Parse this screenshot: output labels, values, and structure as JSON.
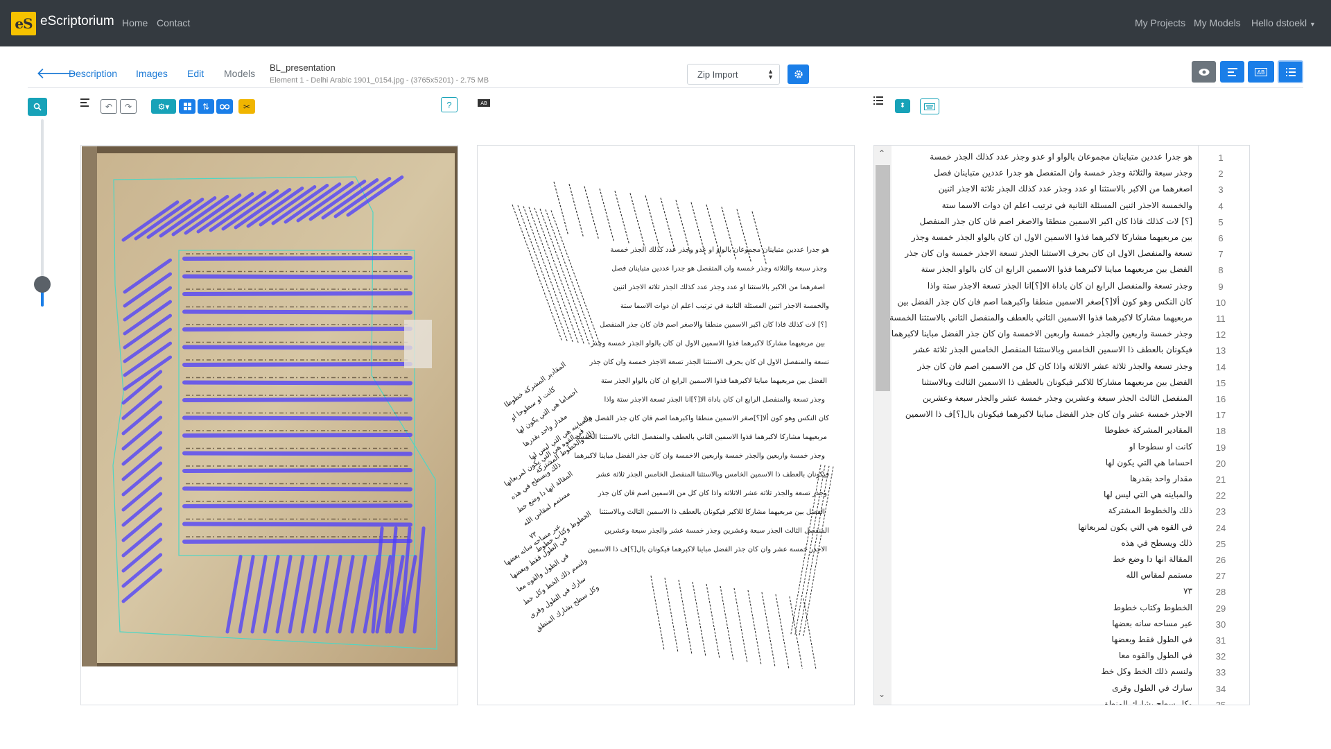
{
  "navbar": {
    "logo_text": "eS",
    "brand": "eScriptorium",
    "home": "Home",
    "contact": "Contact",
    "my_projects": "My Projects",
    "my_models": "My Models",
    "user": "Hello dstoekl"
  },
  "tabs": {
    "description": "Description",
    "images": "Images",
    "edit": "Edit",
    "models": "Models"
  },
  "document": {
    "title": "BL_presentation",
    "subtitle": "Element 1 - Delhi Arabic 1901_0154.jpg - (3765x5201) - 2.75 MB"
  },
  "import_select": {
    "selected": "Zip Import"
  },
  "colors": {
    "accent": "#1a7ee8",
    "navbar": "#343a40",
    "baseline": "#4b3cff",
    "region": "#4fd6c4"
  },
  "icons": {
    "back": "arrow-left-icon",
    "settings": "gear-icon",
    "view": "eye-icon",
    "zoom": "magnifier-icon",
    "help": "question-icon"
  },
  "zoom_level": 0.12,
  "transcription_lines": [
    {
      "n": "1",
      "text": "هو جدرا عددين متباينان مجموعان بالواو او عدو وجذر عدد كذلك الجذر خمسة"
    },
    {
      "n": "2",
      "text": "وجذر سبعة والثلاثة وجذر خمسة وان المتفصل هو جدرا عددين متباينان فصل"
    },
    {
      "n": "3",
      "text": "اصغرهما من الاكبر بالاستثنا او عدد وجذر عدد كذلك الجذر ثلاثة الاجذر اثنين"
    },
    {
      "n": "4",
      "text": "والخمسة الاجذر اثنين المسئلة الثانية في ترتيب اعلم ان دوات الاسما ستة"
    },
    {
      "n": "5",
      "text": "[؟] لات كذلك فاذا كان اكبر الاسمين منطقا والاصغر اصم فان كان جذر المنفصل"
    },
    {
      "n": "6",
      "text": "بين مربعيهما مشاركا لاكبرهما فذوا الاسمين الاول ان كان بالواو الجذر خمسة وجذر"
    },
    {
      "n": "7",
      "text": "تسعة والمنفصل الاول ان كان بحرف الاستثنا الجذر تسعة الاجذر خمسة وان كان جذر"
    },
    {
      "n": "8",
      "text": "الفضل بين مربعيهما مباينا لاكبرهما فذوا الاسمين الرابع ان كان بالواو الجذر ستة"
    },
    {
      "n": "9",
      "text": "وجذر تسعة والمنفصل الرابع ان كان باداة الا[؟]انا الجذر تسعة الاجذر ستة واذا"
    },
    {
      "n": "10",
      "text": "كان النكس وهو كون ألا[؟]صغر الاسمين منطقا واكبرهما اصم فان كان جذر الفضل بين"
    },
    {
      "n": "11",
      "text": "مربعيهما مشاركا لاكبرهما فذوا الاسمين الثاني بالعطف والمنفصل الثاني بالاستثنا الخمسة"
    },
    {
      "n": "12",
      "text": "وجذر خمسة واربعين والجذر خمسة واربعين الاخمسة وان كان جذر الفضل مباينا لاكبرهما"
    },
    {
      "n": "13",
      "text": "فيكونان بالعطف ذا الاسمين الخامس وبالاستثنا المنفصل الخامس الجذر ثلاثة عشر"
    },
    {
      "n": "14",
      "text": "وجذر تسعة والجذر ثلاثة عشر الاثلاثة واذا كان كل من الاسمين اصم فان كان جذر"
    },
    {
      "n": "15",
      "text": "الفضل بين مربعيهما مشاركا للاكبر فيكونان بالعطف ذا الاسمين الثالث وبالاستثنا"
    },
    {
      "n": "16",
      "text": "المنفصل الثالث الجذر سبعة وعشرين وجذر خمسة عشر والجذر سبعة وعشرين"
    },
    {
      "n": "17",
      "text": "الاجذر خمسة عشر وان كان جذر الفضل مباينا لاكبرهما فيكونان بال[؟]ف ذا الاسمين"
    },
    {
      "n": "18",
      "text": "المقادير المشركة خطوطا"
    },
    {
      "n": "19",
      "text": "كانت او سطوحا او"
    },
    {
      "n": "20",
      "text": "احساما هي التي يكون لها"
    },
    {
      "n": "21",
      "text": "مقدار واحد بقدرها"
    },
    {
      "n": "22",
      "text": "والمباينه هي التي ليس لها"
    },
    {
      "n": "23",
      "text": "ذلك والخطوط المشتركة"
    },
    {
      "n": "24",
      "text": "في القوه هي التي يكون لمربعاتها"
    },
    {
      "n": "25",
      "text": "ذلك ويسطح في هذه"
    },
    {
      "n": "26",
      "text": "المقالة انها دا وضع خط"
    },
    {
      "n": "27",
      "text": "مستمم لمقاس الله"
    },
    {
      "n": "28",
      "text": "٧٣"
    },
    {
      "n": "29",
      "text": "الخطوط وكتاب خطوط"
    },
    {
      "n": "30",
      "text": "عبر مساحه سانه بعضها"
    },
    {
      "n": "31",
      "text": "في الطول فقط وبعضها"
    },
    {
      "n": "32",
      "text": "في الطول والقوه معا"
    },
    {
      "n": "33",
      "text": "ولنسم ذلك الخط وكل خط"
    },
    {
      "n": "34",
      "text": "سارك في الطول وقرى"
    },
    {
      "n": "35",
      "text": "وكل سطح يشارك المنطق"
    }
  ]
}
